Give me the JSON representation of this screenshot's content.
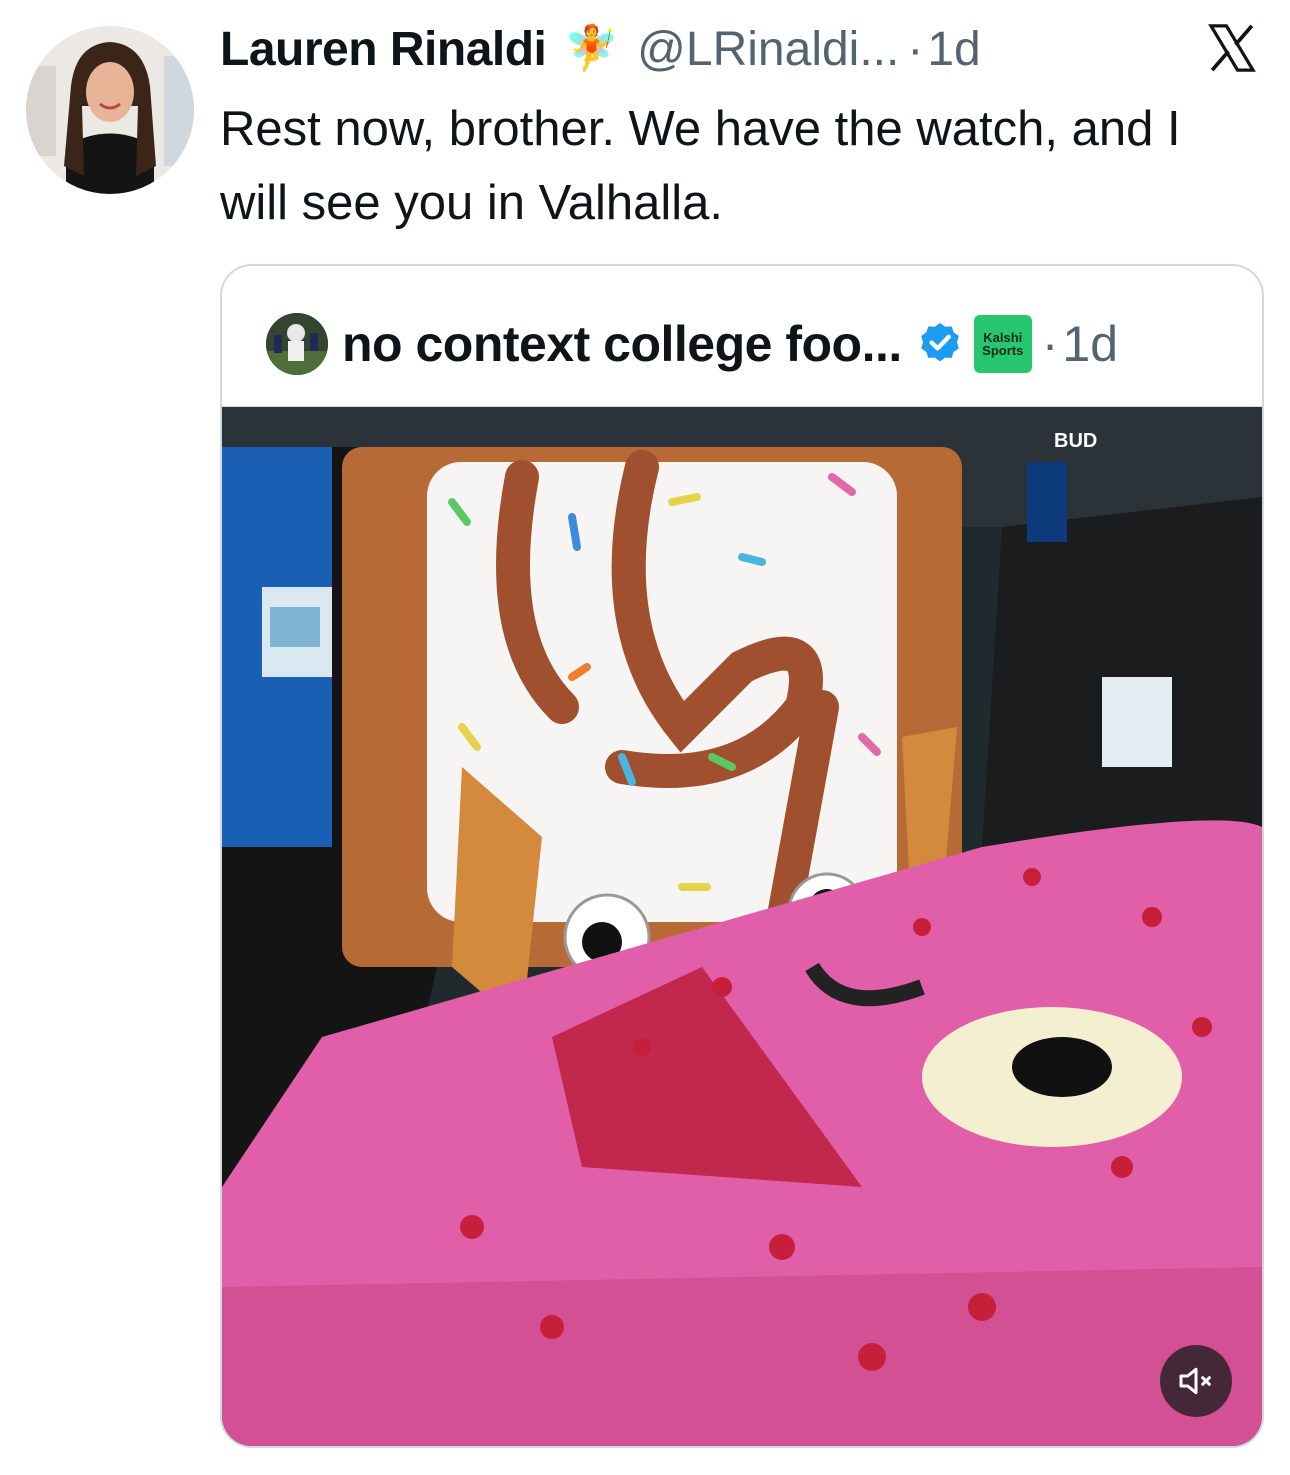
{
  "tweet": {
    "author_name": "Lauren Rinaldi",
    "author_emoji": "🧚",
    "handle": "@LRinaldi...",
    "separator": "·",
    "time": "1d",
    "text": "Rest now, brother. We have the watch, and I will see you in Valhalla."
  },
  "quoted": {
    "author_name": "no context college foo...",
    "badge_line1": "Kalshi",
    "badge_line2": "Sports",
    "separator": "·",
    "time": "1d",
    "media_overlay_text": "BUD"
  },
  "icons": {
    "platform": "x-logo-icon",
    "verified": "verified-badge-icon",
    "mute": "speaker-muted-icon"
  },
  "colors": {
    "text_primary": "#0f1419",
    "text_secondary": "#536471",
    "verified_blue": "#1d9bf0",
    "kalshi_green": "#28c76f",
    "card_border": "#cfd9de"
  }
}
